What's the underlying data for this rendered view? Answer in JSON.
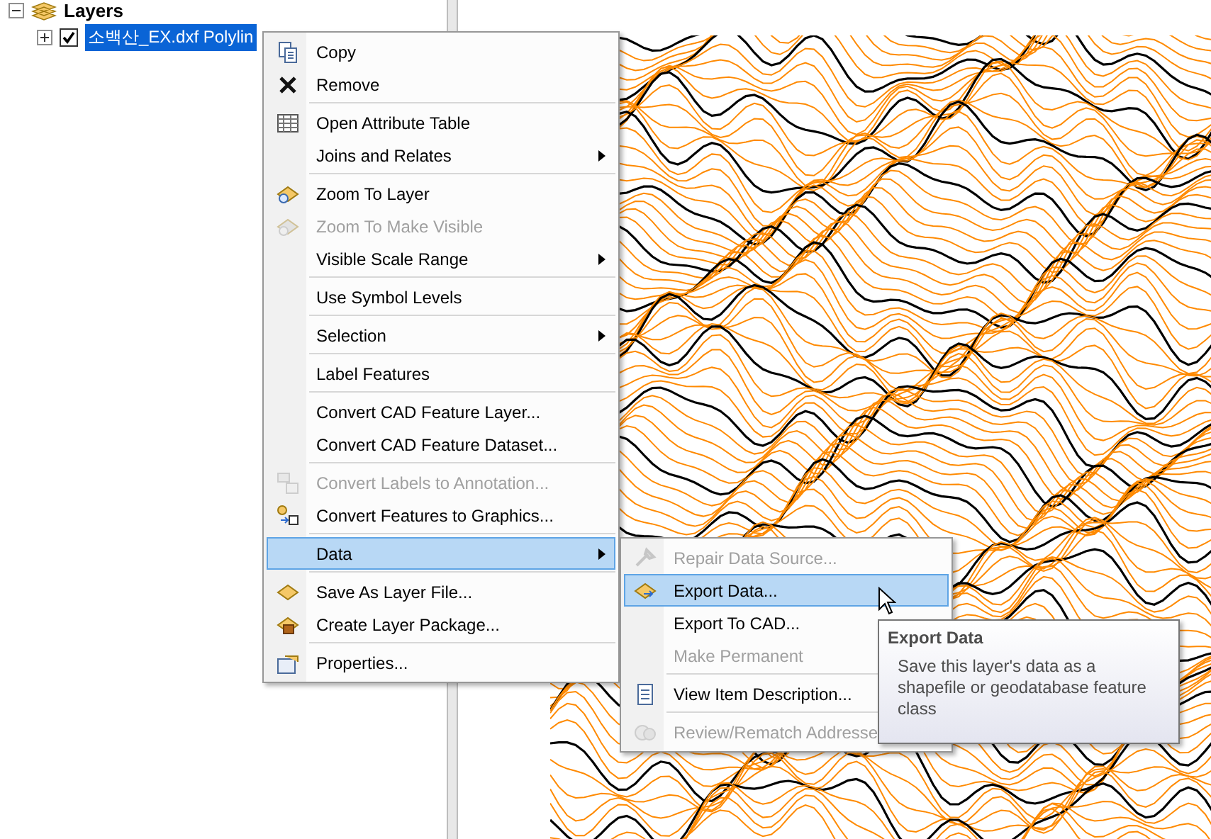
{
  "toc": {
    "root": {
      "label": "Layers",
      "expanded": true
    },
    "layers": [
      {
        "label": "소백산_EX.dxf Polylin",
        "expanded": false,
        "checked": true,
        "selected": true
      }
    ]
  },
  "context_menu": {
    "groups": [
      [
        {
          "label": "Copy",
          "disabled": false,
          "submenu": false,
          "selected": false
        },
        {
          "label": "Remove",
          "disabled": false,
          "submenu": false,
          "selected": false
        }
      ],
      [
        {
          "label": "Open Attribute Table",
          "disabled": false,
          "submenu": false,
          "selected": false
        },
        {
          "label": "Joins and Relates",
          "disabled": false,
          "submenu": true,
          "selected": false
        }
      ],
      [
        {
          "label": "Zoom To Layer",
          "disabled": false,
          "submenu": false,
          "selected": false
        },
        {
          "label": "Zoom To Make Visible",
          "disabled": true,
          "submenu": false,
          "selected": false
        },
        {
          "label": "Visible Scale Range",
          "disabled": false,
          "submenu": true,
          "selected": false
        }
      ],
      [
        {
          "label": "Use Symbol Levels",
          "disabled": false,
          "submenu": false,
          "selected": false
        }
      ],
      [
        {
          "label": "Selection",
          "disabled": false,
          "submenu": true,
          "selected": false
        }
      ],
      [
        {
          "label": "Label Features",
          "disabled": false,
          "submenu": false,
          "selected": false
        }
      ],
      [
        {
          "label": "Convert CAD Feature Layer...",
          "disabled": false,
          "submenu": false,
          "selected": false
        },
        {
          "label": "Convert CAD Feature Dataset...",
          "disabled": false,
          "submenu": false,
          "selected": false
        }
      ],
      [
        {
          "label": "Convert Labels to Annotation...",
          "disabled": true,
          "submenu": false,
          "selected": false
        },
        {
          "label": "Convert Features to Graphics...",
          "disabled": false,
          "submenu": false,
          "selected": false
        }
      ],
      [
        {
          "label": "Data",
          "disabled": false,
          "submenu": true,
          "selected": true
        }
      ],
      [
        {
          "label": "Save As Layer File...",
          "disabled": false,
          "submenu": false,
          "selected": false
        },
        {
          "label": "Create Layer Package...",
          "disabled": false,
          "submenu": false,
          "selected": false
        }
      ],
      [
        {
          "label": "Properties...",
          "disabled": false,
          "submenu": false,
          "selected": false
        }
      ]
    ]
  },
  "submenu": {
    "groups": [
      [
        {
          "label": "Repair Data Source...",
          "disabled": true,
          "selected": false
        },
        {
          "label": "Export Data...",
          "disabled": false,
          "selected": true
        },
        {
          "label": "Export To CAD...",
          "disabled": false,
          "selected": false
        },
        {
          "label": "Make Permanent",
          "disabled": true,
          "selected": false
        }
      ],
      [
        {
          "label": "View Item Description...",
          "disabled": false,
          "selected": false
        }
      ],
      [
        {
          "label": "Review/Rematch Addresse",
          "disabled": true,
          "selected": false
        }
      ]
    ]
  },
  "tooltip": {
    "title": "Export Data",
    "text": "Save this layer's data as a shapefile or geodatabase feature class"
  }
}
